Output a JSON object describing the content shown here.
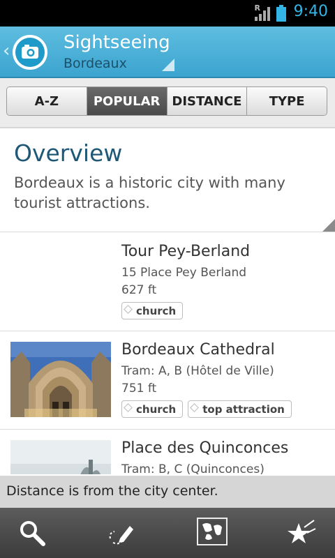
{
  "status_bar": {
    "time": "9:40",
    "roaming": "R"
  },
  "header": {
    "title": "Sightseeing",
    "subtitle": "Bordeaux",
    "back_icon": "chevron-left-icon",
    "app_icon": "camera-icon"
  },
  "tabs": [
    {
      "label": "A-Z",
      "active": false
    },
    {
      "label": "POPULAR",
      "active": true
    },
    {
      "label": "DISTANCE",
      "active": false
    },
    {
      "label": "TYPE",
      "active": false
    }
  ],
  "overview": {
    "title": "Overview",
    "text": "Bordeaux is a historic city with many tourist attractions."
  },
  "items": [
    {
      "name": "Tour Pey-Berland",
      "address": "15 Place Pey Berland",
      "distance": "627 ft",
      "tags": [
        "church"
      ]
    },
    {
      "name": "Bordeaux Cathedral",
      "address": "Tram: A, B (Hôtel de Ville)",
      "distance": "751 ft",
      "tags": [
        "church",
        "top attraction"
      ]
    },
    {
      "name": "Place des Quinconces",
      "address": "Tram: B, C (Quinconces)",
      "distance": "",
      "tags": []
    }
  ],
  "notice": "Distance is from the city center.",
  "bottom_bar": {
    "icons": [
      "search-icon",
      "route-pen-icon",
      "map-icon",
      "favorites-star-icon"
    ]
  },
  "colors": {
    "accent": "#33b5e5",
    "header": "#4ab0d8",
    "title_blue": "#1f5877"
  }
}
